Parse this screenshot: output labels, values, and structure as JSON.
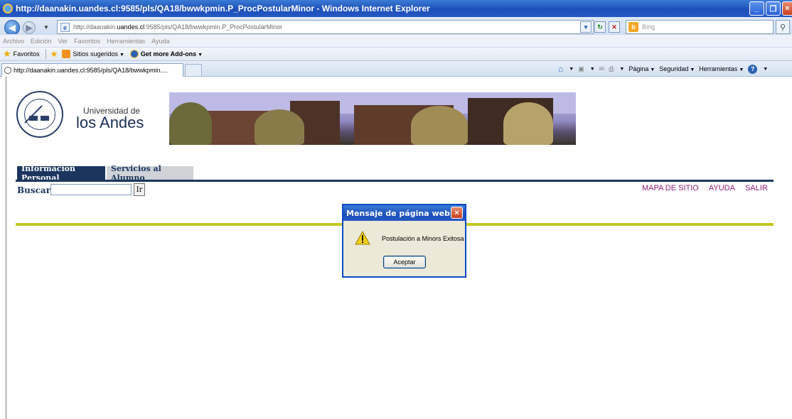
{
  "window": {
    "title": "http://daanakin.uandes.cl:9585/pls/QA18/bwwkpmin.P_ProcPostularMinor - Windows Internet Explorer"
  },
  "address_bar": {
    "url_prefix": "http://daanakin.",
    "url_domain": "uandes.cl",
    "url_suffix": ":9585/pls/QA18/bwwkpmin.P_ProcPostularMinor",
    "search_placeholder": "Bing"
  },
  "menu": [
    "Archivo",
    "Edición",
    "Ver",
    "Favoritos",
    "Herramientas",
    "Ayuda"
  ],
  "favorites_bar": {
    "favorites_label": "Favoritos",
    "suggested_sites": "Sitios sugeridos",
    "addons": "Get more Add-ons"
  },
  "tabs": {
    "active_tab_title": "http://daanakin.uandes.cl:9585/pls/QA18/bwwkpmin...."
  },
  "command_bar": {
    "page": "Página",
    "security": "Seguridad",
    "tools": "Herramientas"
  },
  "page": {
    "university_line1": "Universidad de",
    "university_line2": "los Andes",
    "nav_tabs": [
      {
        "label": "Información Personal",
        "active": true
      },
      {
        "label": "Servicios al Alumno",
        "active": false
      }
    ],
    "search_label": "Buscar",
    "search_button": "Ir",
    "top_links": [
      "MAPA DE SITIO",
      "AYUDA",
      "SALIR"
    ],
    "colors": {
      "navy": "#1b355e",
      "link": "#8c1f75",
      "accent_line": "#c4c622"
    }
  },
  "dialog": {
    "title": "Mensaje de página web",
    "message": "Postulación a Minors Exitosa",
    "button": "Aceptar",
    "icon": "warning-icon"
  }
}
